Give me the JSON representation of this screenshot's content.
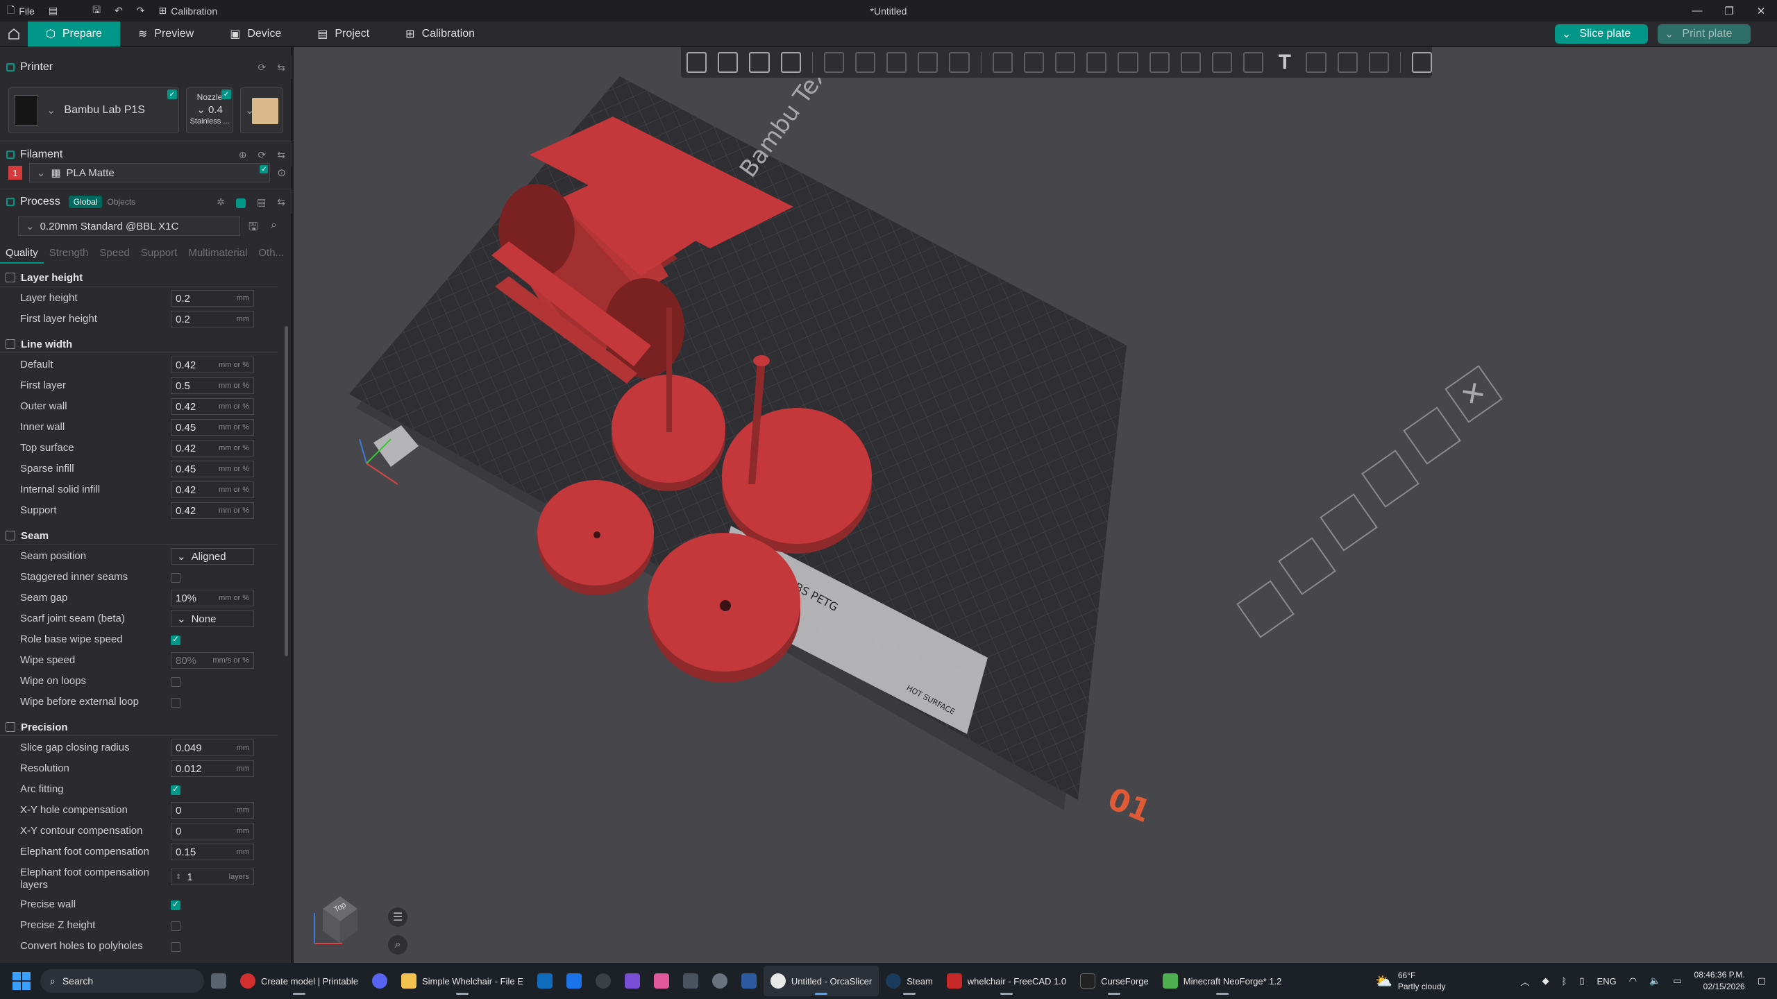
{
  "titlebar": {
    "file": "File",
    "calibration": "Calibration",
    "document": "*Untitled"
  },
  "nav": {
    "tabs": [
      {
        "label": "Prepare"
      },
      {
        "label": "Preview"
      },
      {
        "label": "Device"
      },
      {
        "label": "Project"
      },
      {
        "label": "Calibration"
      }
    ],
    "slice_label": "Slice plate",
    "print_label": "Print plate"
  },
  "printer": {
    "section": "Printer",
    "name": "Bambu Lab P1S",
    "nozzle_label": "Nozzle",
    "nozzle_value": "0.4",
    "nozzle_type": "Stainless ..."
  },
  "filament": {
    "section": "Filament",
    "slot": "1",
    "name": "PLA Matte"
  },
  "process": {
    "section": "Process",
    "global": "Global",
    "objects": "Objects",
    "preset": "0.20mm Standard @BBL X1C",
    "tabs": [
      "Quality",
      "Strength",
      "Speed",
      "Support",
      "Multimaterial",
      "Oth..."
    ]
  },
  "groups": {
    "layer_height": "Layer height",
    "line_width": "Line width",
    "seam": "Seam",
    "precision": "Precision"
  },
  "params": {
    "layer_height": {
      "label": "Layer height",
      "value": "0.2",
      "unit": "mm"
    },
    "first_layer_height": {
      "label": "First layer height",
      "value": "0.2",
      "unit": "mm"
    },
    "lw_default": {
      "label": "Default",
      "value": "0.42",
      "unit": "mm or %"
    },
    "lw_first_layer": {
      "label": "First layer",
      "value": "0.5",
      "unit": "mm or %"
    },
    "lw_outer_wall": {
      "label": "Outer wall",
      "value": "0.42",
      "unit": "mm or %"
    },
    "lw_inner_wall": {
      "label": "Inner wall",
      "value": "0.45",
      "unit": "mm or %"
    },
    "lw_top_surface": {
      "label": "Top surface",
      "value": "0.42",
      "unit": "mm or %"
    },
    "lw_sparse_infill": {
      "label": "Sparse infill",
      "value": "0.45",
      "unit": "mm or %"
    },
    "lw_internal_solid": {
      "label": "Internal solid infill",
      "value": "0.42",
      "unit": "mm or %"
    },
    "lw_support": {
      "label": "Support",
      "value": "0.42",
      "unit": "mm or %"
    },
    "seam_position": {
      "label": "Seam position",
      "value": "Aligned"
    },
    "staggered_inner": {
      "label": "Staggered inner seams"
    },
    "seam_gap": {
      "label": "Seam gap",
      "value": "10%",
      "unit": "mm or %"
    },
    "scarf_joint": {
      "label": "Scarf joint seam (beta)",
      "value": "None"
    },
    "role_base_wipe": {
      "label": "Role base wipe speed"
    },
    "wipe_speed": {
      "label": "Wipe speed",
      "value": "80%",
      "unit": "mm/s or %"
    },
    "wipe_on_loops": {
      "label": "Wipe on loops"
    },
    "wipe_before_ext": {
      "label": "Wipe before external loop"
    },
    "slice_gap": {
      "label": "Slice gap closing radius",
      "value": "0.049",
      "unit": "mm"
    },
    "resolution": {
      "label": "Resolution",
      "value": "0.012",
      "unit": "mm"
    },
    "arc_fitting": {
      "label": "Arc fitting"
    },
    "xy_hole": {
      "label": "X-Y hole compensation",
      "value": "0",
      "unit": "mm"
    },
    "xy_contour": {
      "label": "X-Y contour compensation",
      "value": "0",
      "unit": "mm"
    },
    "elephant_foot": {
      "label": "Elephant foot compensation",
      "value": "0.15",
      "unit": "mm"
    },
    "elephant_layers": {
      "label": "Elephant foot compensation layers",
      "value": "1",
      "unit": "layers"
    },
    "precise_wall": {
      "label": "Precise wall"
    },
    "precise_z": {
      "label": "Precise Z height"
    },
    "convert_holes": {
      "label": "Convert holes to polyholes"
    }
  },
  "viewport": {
    "plate_text": "Bambu Textured PEI Plate",
    "plate_label": "PLA ABS PETG",
    "hot_label": "HOT SURFACE",
    "plate_number": "01",
    "view_cube": "Top",
    "model_color": "#c4373a"
  },
  "taskbar": {
    "search": "Search",
    "apps": [
      {
        "label": "Create model | Printable"
      },
      {
        "label": "Simple Whelchair - File E"
      },
      {
        "label": "Untitled - OrcaSlicer"
      },
      {
        "label": "Steam"
      },
      {
        "label": "whelchair - FreeCAD 1.0"
      },
      {
        "label": "CurseForge"
      },
      {
        "label": "Minecraft NeoForge* 1.2"
      }
    ],
    "weather_temp": "66°F",
    "weather_desc": "Partly cloudy",
    "lang": "ENG",
    "time": "08:46:36 P.M.",
    "date": "02/15/2026"
  }
}
